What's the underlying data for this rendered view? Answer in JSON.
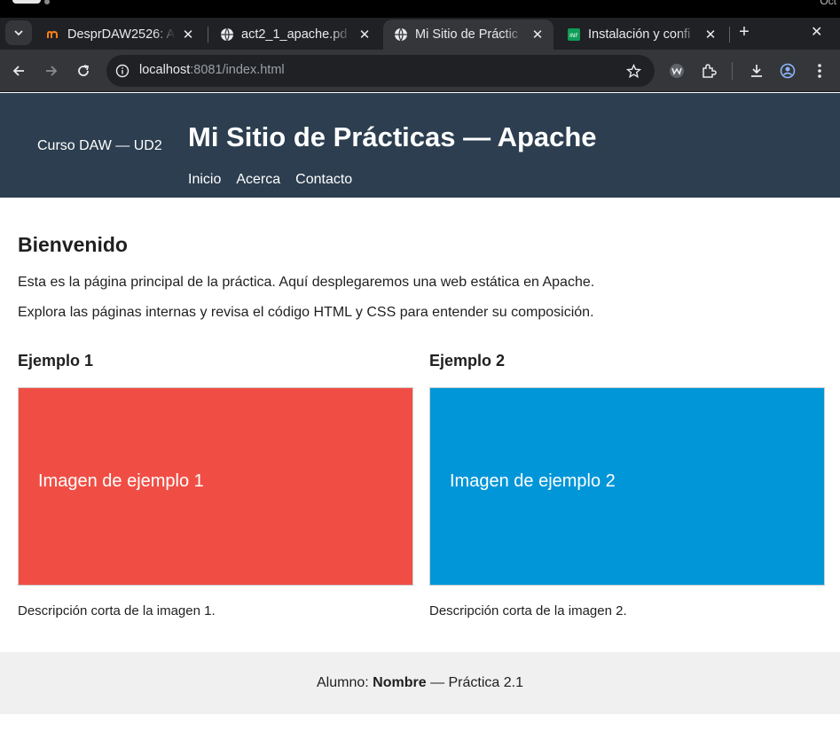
{
  "browser": {
    "tabs": [
      {
        "title": "DesprDAW2526: A",
        "favicon": "moodle-icon",
        "active": false
      },
      {
        "title": "act2_1_apache.pd",
        "favicon": "globe-icon",
        "active": false
      },
      {
        "title": "Mi Sitio de Práctic",
        "favicon": "globe-icon",
        "active": true
      },
      {
        "title": "Instalación y confi",
        "favicon": "sheets-icon",
        "active": false
      }
    ],
    "url_host": "localhost",
    "url_rest": ":8081/index.html",
    "colors": {
      "tabbar": "#202124",
      "toolbar": "#35363a"
    }
  },
  "header": {
    "brand": "Curso DAW — UD2",
    "title": "Mi Sitio de Prácticas — Apache",
    "nav": [
      "Inicio",
      "Acerca",
      "Contacto"
    ],
    "bg_color": "#2c3e50"
  },
  "main": {
    "heading": "Bienvenido",
    "paragraphs": [
      "Esta es la página principal de la práctica. Aquí desplegaremos una web estática en Apache.",
      "Explora las páginas internas y revisa el código HTML y CSS para entender su composición."
    ],
    "cards": [
      {
        "title": "Ejemplo 1",
        "image_text": "Imagen de ejemplo 1",
        "caption": "Descripción corta de la imagen 1.",
        "color": "#f04e45"
      },
      {
        "title": "Ejemplo 2",
        "image_text": "Imagen de ejemplo 2",
        "caption": "Descripción corta de la imagen 2.",
        "color": "#0096d8"
      }
    ]
  },
  "footer": {
    "prefix": "Alumno:",
    "name": "Nombre",
    "suffix": "— Práctica 2.1"
  }
}
